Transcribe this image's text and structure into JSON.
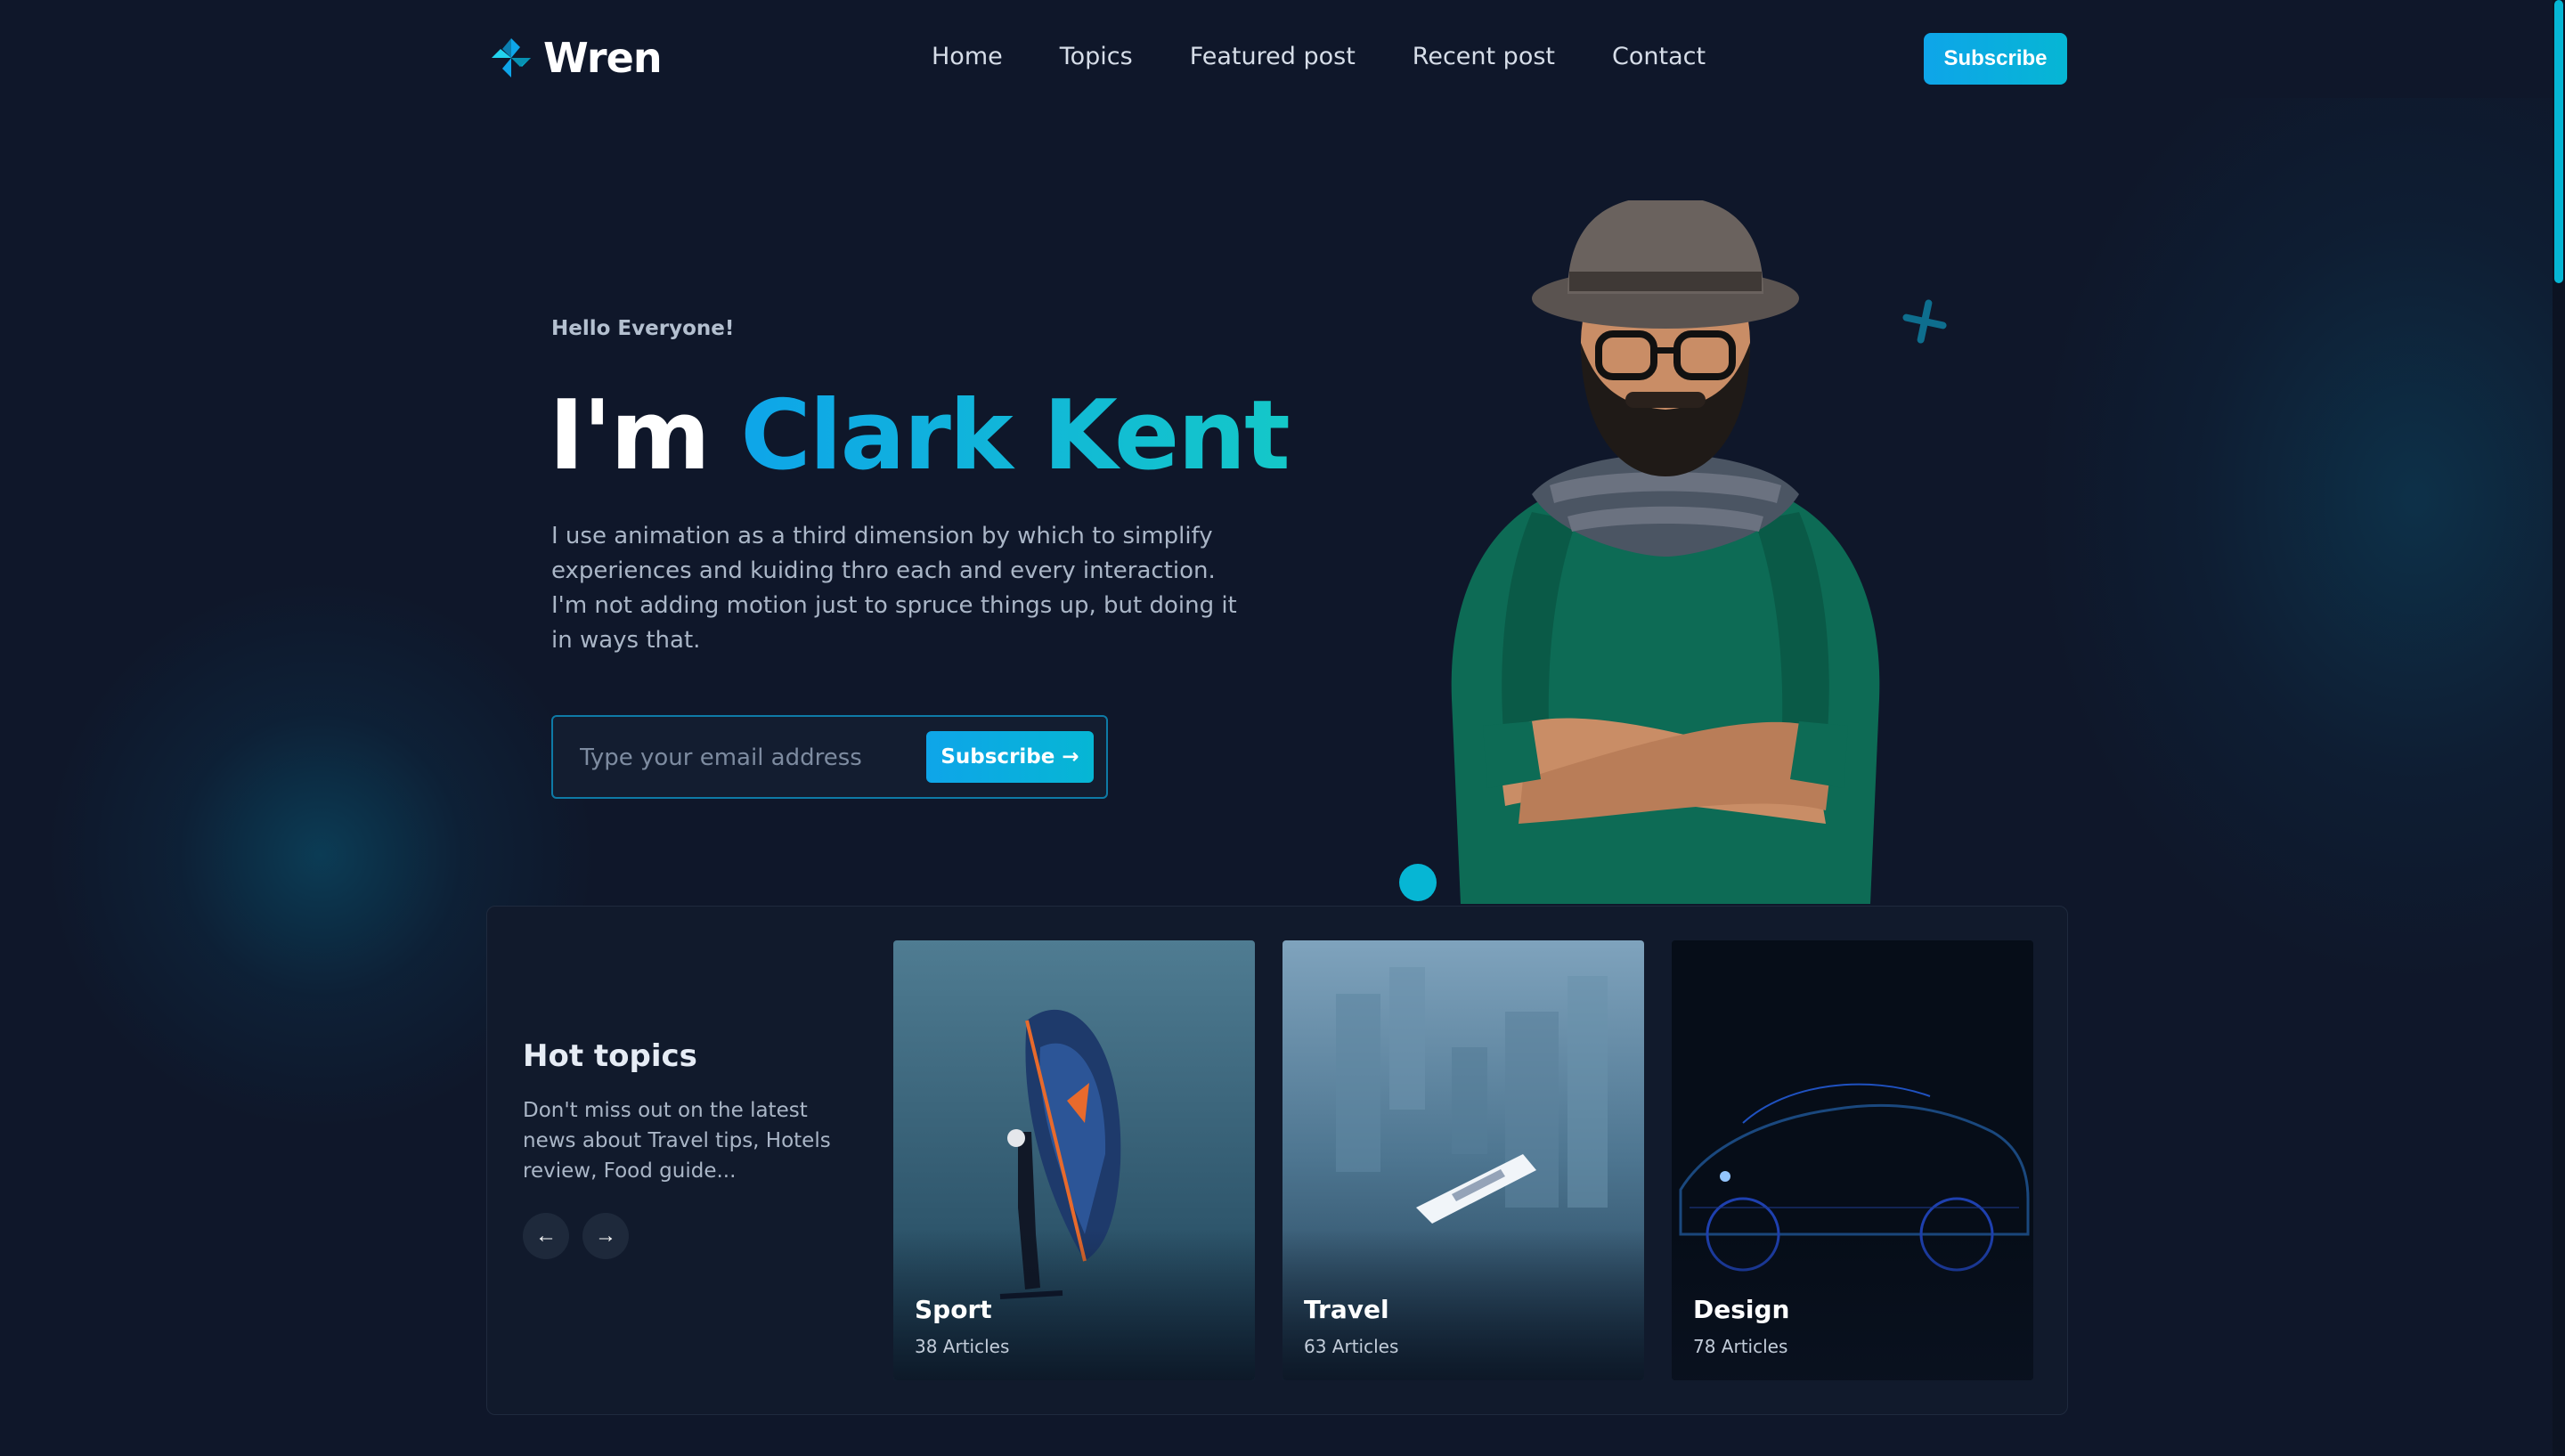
{
  "brand": {
    "name": "Wren",
    "logo_icon": "pinwheel-logo-icon",
    "accent": "#0ea5e9",
    "accent_alt": "#06b6d4"
  },
  "nav": {
    "items": [
      {
        "label": "Home"
      },
      {
        "label": "Topics"
      },
      {
        "label": "Featured post"
      },
      {
        "label": "Recent post"
      },
      {
        "label": "Contact"
      }
    ],
    "subscribe_label": "Subscribe"
  },
  "hero": {
    "greeting": "Hello Everyone!",
    "title_prefix": "I'm",
    "title_name": "Clark Kent",
    "description": "I use animation as a third dimension by which to simplify experiences and kuiding thro each and every interaction. I'm not adding motion just to spruce things up, but doing it in ways that.",
    "email_placeholder": "Type your email address",
    "subscribe_label": "Subscribe",
    "subscribe_icon": "arrow-right-icon"
  },
  "hot_topics": {
    "title": "Hot topics",
    "description": "Don't miss out on the latest news about Travel tips, Hotels review, Food guide...",
    "prev_icon": "arrow-left-icon",
    "next_icon": "arrow-right-icon",
    "cards": [
      {
        "name": "Sport",
        "count": "38 Articles"
      },
      {
        "name": "Travel",
        "count": "63 Articles"
      },
      {
        "name": "Design",
        "count": "78 Articles"
      }
    ]
  }
}
